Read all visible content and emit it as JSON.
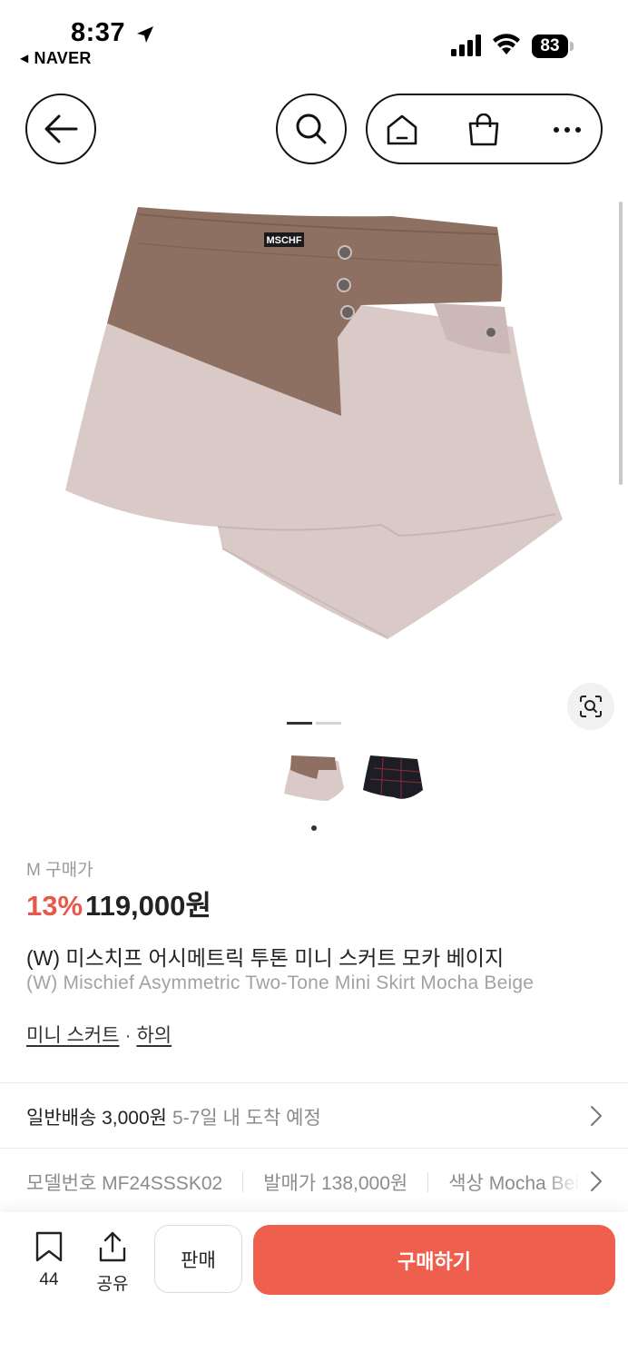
{
  "status_bar": {
    "time": "8:37",
    "back_app": "NAVER",
    "battery": "83"
  },
  "nav": {
    "icons": [
      "back-arrow-icon",
      "search-icon",
      "home-icon",
      "shopping-bag-icon",
      "more-icon"
    ]
  },
  "product": {
    "image_brand_tag": "MSCHF",
    "image_pager": {
      "current": 1,
      "total": 2
    },
    "thumbnails": [
      "mocha-beige-skirt",
      "black-plaid-skirt"
    ],
    "size_label": "M 구매가",
    "discount": "13%",
    "price": "119,000원",
    "title_ko": "(W) 미스치프 어시메트릭 투톤 미니 스커트 모카 베이지",
    "title_en": "(W) Mischief Asymmetric Two-Tone Mini Skirt Mocha Beige",
    "category_1": "미니 스커트",
    "category_sep": "·",
    "category_2": "하의"
  },
  "shipping": {
    "main": "일반배송 3,000원",
    "sub": "5-7일 내 도착 예정"
  },
  "specs": [
    {
      "label": "모델번호 MF24SSSK02"
    },
    {
      "label": "발매가 138,000원"
    },
    {
      "label": "색상 Mocha Beige"
    }
  ],
  "bottom_bar": {
    "like_count": "44",
    "share_label": "공유",
    "sell_label": "판매",
    "buy_label": "구매하기"
  },
  "colors": {
    "accent": "#ef5f4e",
    "discount": "#e8584a",
    "mocha": "#8d7061",
    "beige": "#d8c8c6"
  }
}
